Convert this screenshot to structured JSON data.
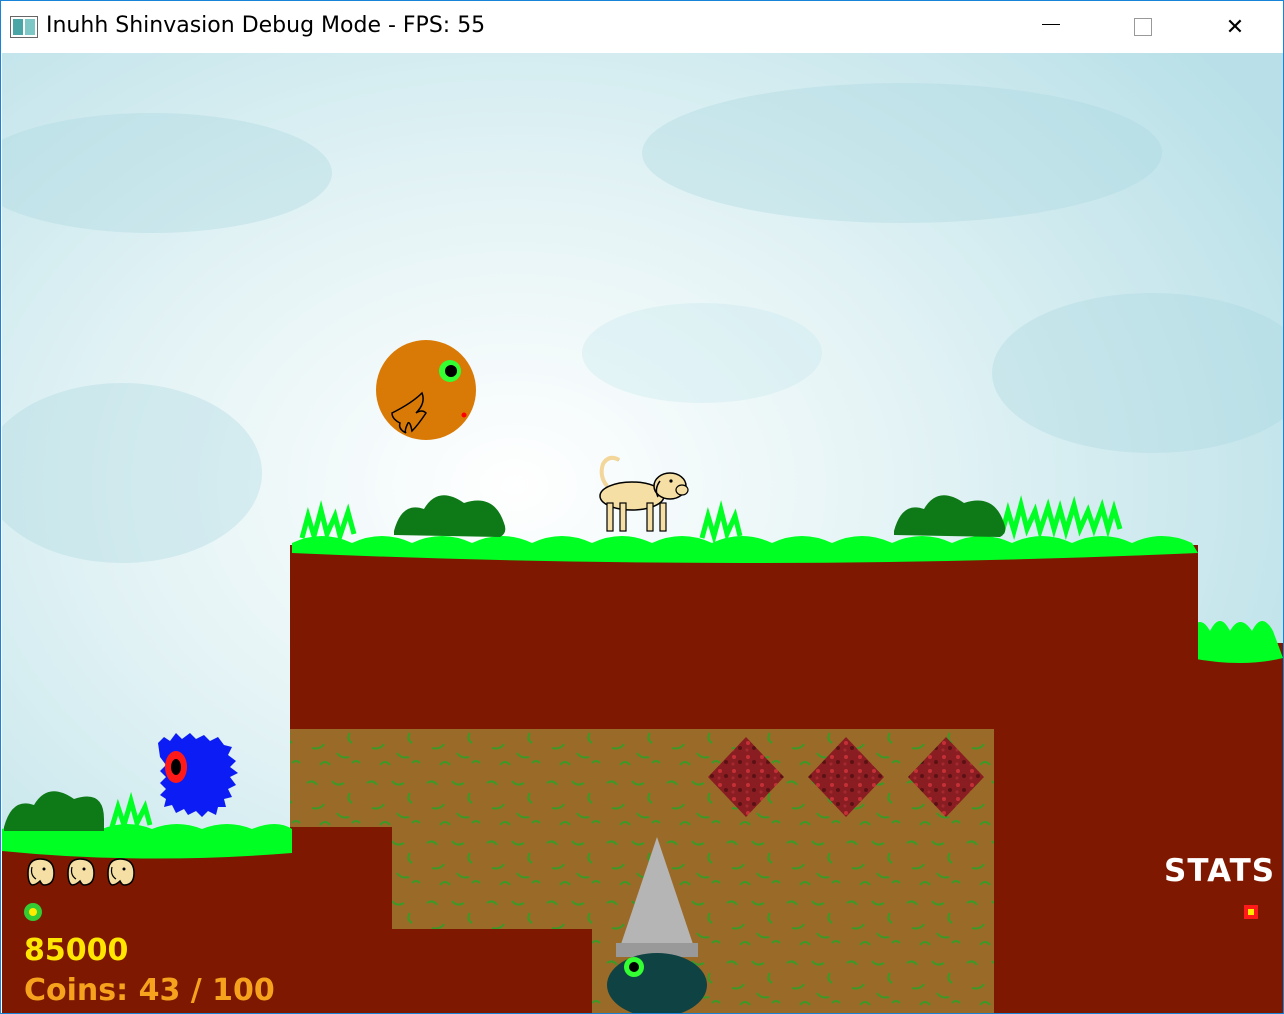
{
  "window": {
    "title": "Inuhh Shinvasion Debug Mode - FPS: 55",
    "icon": "app-icon",
    "controls": {
      "minimize": "minimize-icon",
      "maximize": "maximize-icon",
      "close": "close-icon"
    }
  },
  "hud": {
    "lives_count": 3,
    "lives_icon": "dog-head-icon",
    "gem_icon": "green-gem-icon",
    "score": "85000",
    "coins_text": "Coins: 43 / 100",
    "stats_label": "STATS",
    "stats_icon": "red-gem-icon"
  },
  "colors": {
    "sky": "#dcf1f4",
    "dirt": "#7f1800",
    "grass": "#00ff22",
    "score": "#ffe600",
    "coins": "#f7a21c",
    "enemy_blue": "#0c1cf4",
    "enemy_orange": "#d97a07"
  }
}
